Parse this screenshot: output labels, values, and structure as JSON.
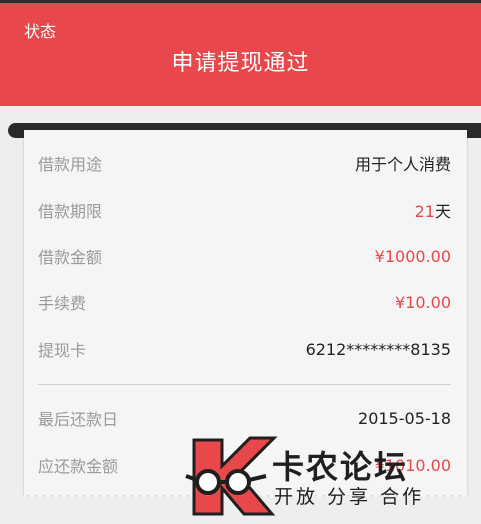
{
  "header": {
    "status_label": "状态",
    "title": "申请提现通过"
  },
  "details": {
    "rows": [
      {
        "label": "借款用途",
        "value": "用于个人消费",
        "color": "#222222"
      },
      {
        "label": "借款期限",
        "value": "21",
        "unit": "天",
        "color": "#e8484c"
      },
      {
        "label": "借款金额",
        "value": "¥1000.00",
        "color": "#e8484c"
      },
      {
        "label": "手续费",
        "value": "¥10.00",
        "color": "#e8484c"
      },
      {
        "label": "提现卡",
        "value": "6212********8135",
        "color": "#222222"
      }
    ],
    "rows2": [
      {
        "label": "最后还款日",
        "value": "2015-05-18",
        "color": "#222222"
      },
      {
        "label": "应还款金额",
        "value": "¥1010.00",
        "color": "#e8484c"
      }
    ]
  },
  "watermark": {
    "line1": "卡农论坛",
    "line2": "开放 分享 合作"
  },
  "colors": {
    "accent": "#e8484c"
  }
}
